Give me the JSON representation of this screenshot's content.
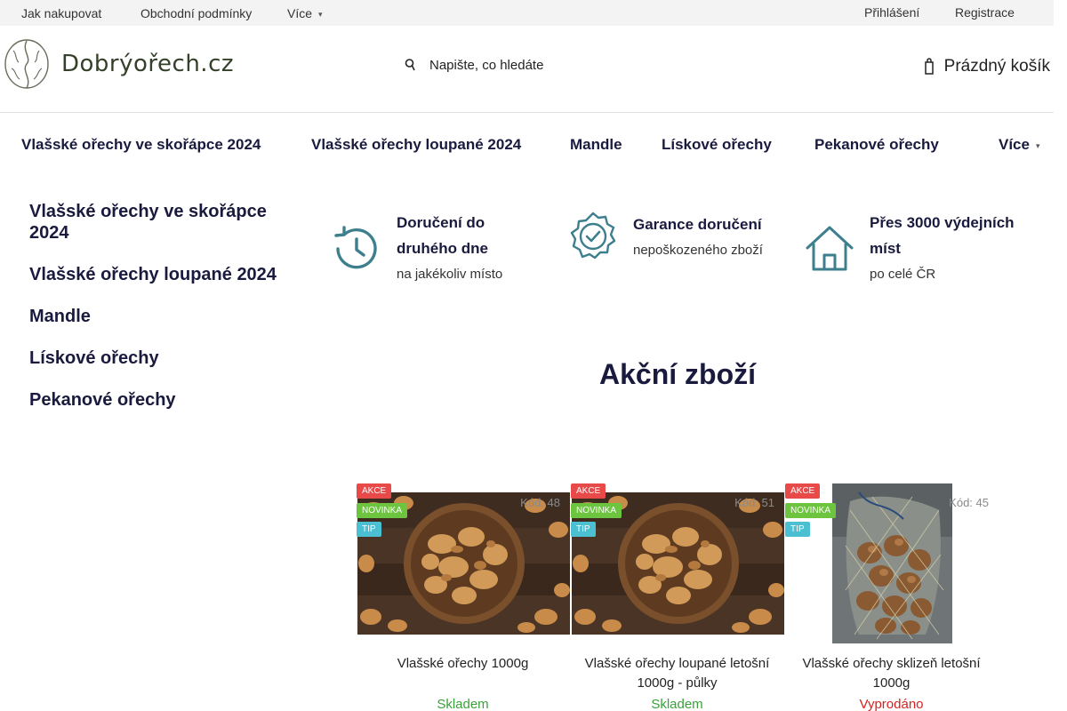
{
  "topbar": {
    "links": [
      "Jak nakupovat",
      "Obchodní podmínky",
      "Více"
    ],
    "account": [
      "Přihlášení",
      "Registrace"
    ]
  },
  "header": {
    "logo_text": "Dobrýořech.cz",
    "search_placeholder": "Napište, co hledáte",
    "cart_label": "Prázdný košík"
  },
  "categories": [
    "Vlašské ořechy ve skořápce 2024",
    "Vlašské ořechy loupané 2024",
    "Mandle",
    "Lískové ořechy",
    "Pekanové ořechy",
    "Více"
  ],
  "sidebar": {
    "items": [
      "Vlašské ořechy ve skořápce 2024",
      "Vlašské ořechy loupané 2024",
      "Mandle",
      "Lískové ořechy",
      "Pekanové ořechy"
    ]
  },
  "benefits": [
    {
      "icon": "clock-icon",
      "title": "Doručení do druhého dne",
      "subtitle": "na jakékoliv místo"
    },
    {
      "icon": "badge-check-icon",
      "title": "Garance doručení",
      "subtitle": "nepoškozeného zboží"
    },
    {
      "icon": "house-icon",
      "title": "Přes 3000 výdejních míst",
      "subtitle": "po celé ČR"
    }
  ],
  "section_title": "Akční zboží",
  "products": [
    {
      "flags": [
        "AKCE",
        "NOVINKA",
        "TIP"
      ],
      "code": "Kód: 48",
      "name": "Vlašské ořechy 1000g",
      "stock": "Skladem",
      "stock_color": "#3aa13a"
    },
    {
      "flags": [
        "AKCE",
        "NOVINKA",
        "TIP"
      ],
      "code": "Kód: 51",
      "name": "Vlašské ořechy loupané letošní 1000g - půlky",
      "stock": "Skladem",
      "stock_color": "#3aa13a"
    },
    {
      "flags": [
        "AKCE",
        "NOVINKA",
        "TIP"
      ],
      "code": "Kód: 45",
      "name": "Vlašské ořechy sklizeň letošní 1000g",
      "stock": "Vyprodáno",
      "stock_color": "#d6231f"
    }
  ],
  "colors": {
    "akce": "#e84a4a",
    "novinka": "#6dc43f",
    "tip": "#4bc0d3",
    "heading": "#1a1a3e",
    "icon_accent": "#3d7f8c"
  }
}
